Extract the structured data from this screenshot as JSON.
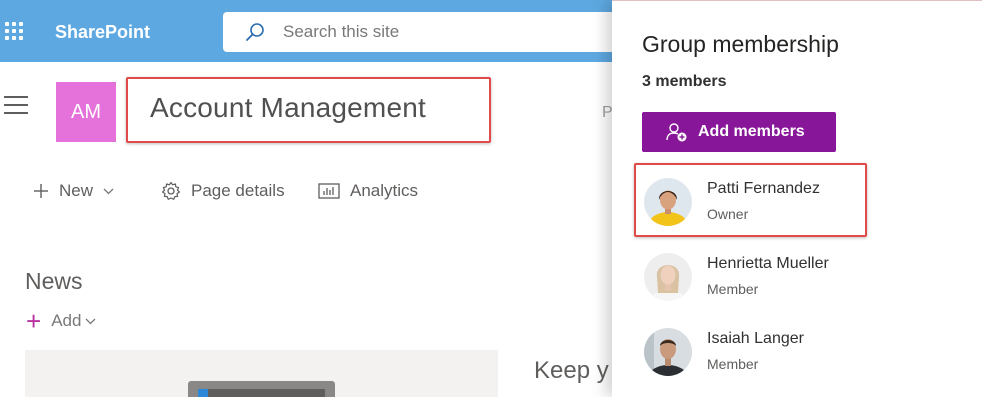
{
  "suite_bar": {
    "app_name": "SharePoint",
    "search_placeholder": "Search this site",
    "color": "#5ea8e1"
  },
  "site": {
    "logo_initials": "AM",
    "logo_color": "#e571db",
    "title": "Account Management",
    "obscured_text": "P"
  },
  "command_bar": {
    "new_label": "New",
    "page_details_label": "Page details",
    "analytics_label": "Analytics"
  },
  "news": {
    "title": "News",
    "add_label": "Add"
  },
  "partial_heading": "Keep y",
  "panel": {
    "title": "Group membership",
    "member_count": "3 members",
    "add_members_label": "Add members",
    "accent_color": "#871699",
    "members": [
      {
        "name": "Patti Fernandez",
        "role": "Owner"
      },
      {
        "name": "Henrietta Mueller",
        "role": "Member"
      },
      {
        "name": "Isaiah Langer",
        "role": "Member"
      }
    ]
  },
  "annotation_color": "#e04a48",
  "icons": [
    "waffle-icon",
    "search-icon",
    "hamburger-icon",
    "plus-icon",
    "chevron-down-icon",
    "gear-icon",
    "analytics-icon",
    "add-member-icon"
  ]
}
